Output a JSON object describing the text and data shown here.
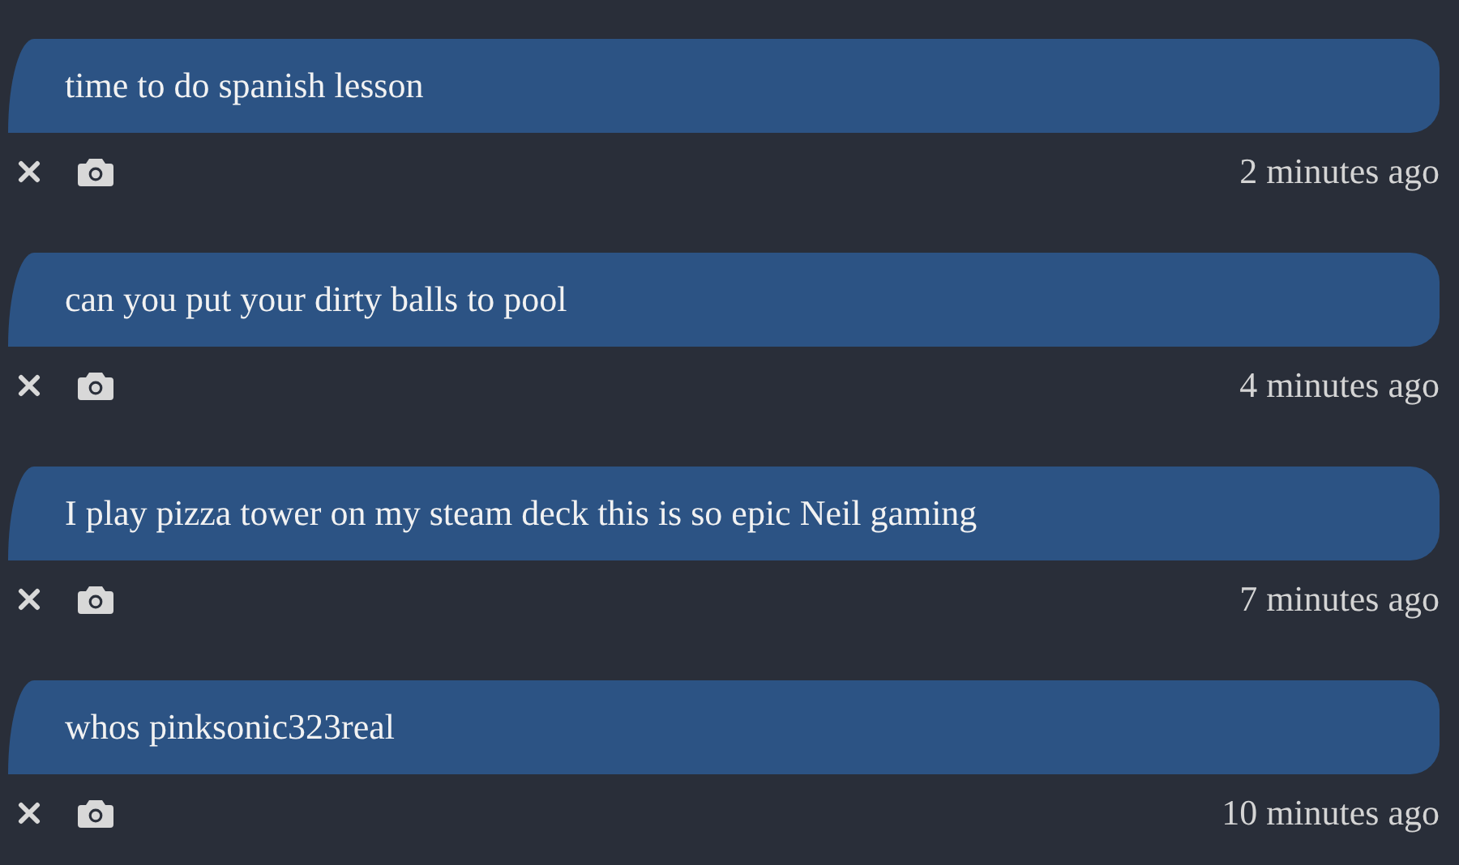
{
  "messages": [
    {
      "text": "time to do spanish lesson",
      "time": "2 minutes ago"
    },
    {
      "text": "can you put your dirty balls to pool",
      "time": "4 minutes ago"
    },
    {
      "text": "I play pizza tower on my steam deck this is so epic Neil gaming",
      "time": "7 minutes ago"
    },
    {
      "text": "whos pinksonic323real",
      "time": "10 minutes ago"
    }
  ]
}
